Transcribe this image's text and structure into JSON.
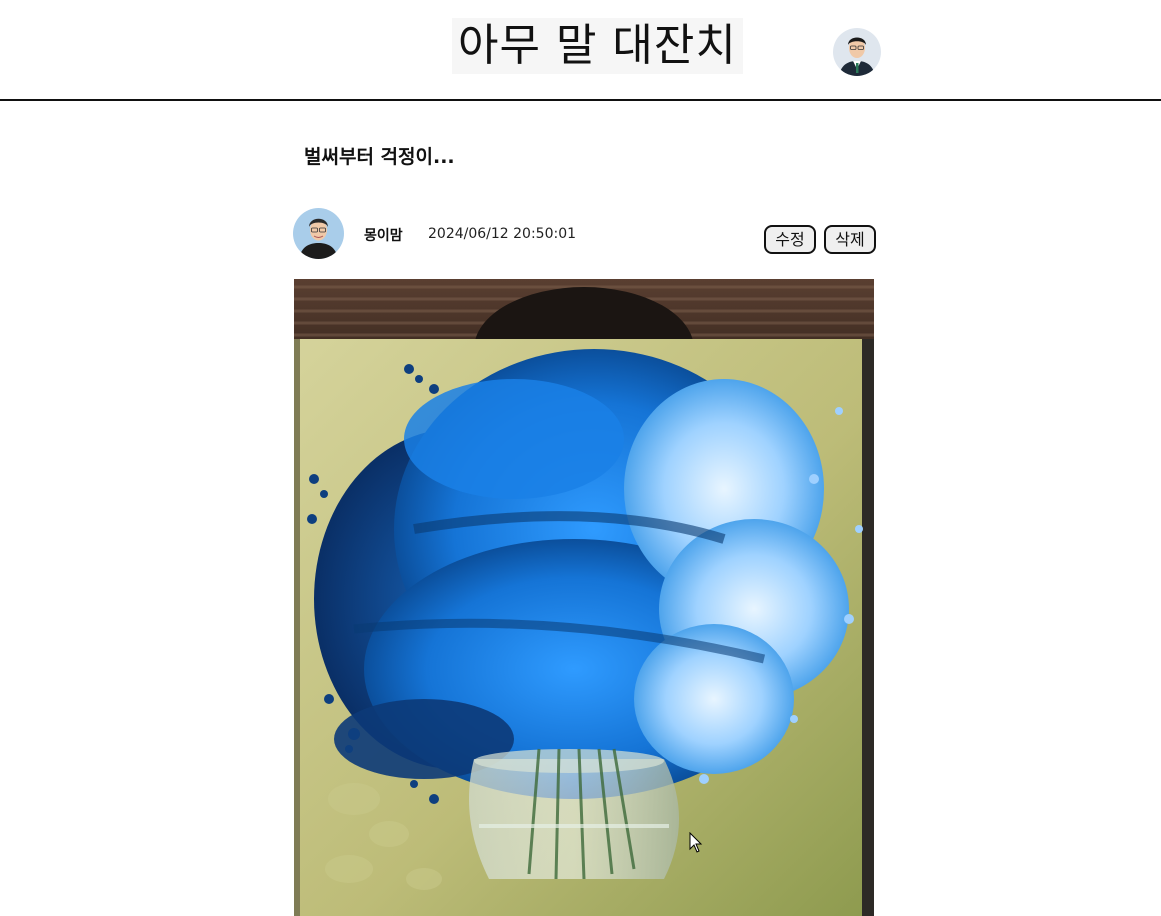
{
  "header": {
    "site_title": "아무 말 대잔치",
    "avatar_icon": "user-avatar-icon"
  },
  "post": {
    "title": "벌써부터 걱정이...",
    "author_name": "몽이맘",
    "date": "2024/06/12 20:50:01",
    "edit_label": "수정",
    "delete_label": "삭제",
    "image_icon": "flower-painting-image"
  },
  "colors": {
    "text": "#111111",
    "divider": "#111111",
    "button_bg": "#efefef",
    "flower_blue": "#1a7fe0",
    "canvas_olive": "#b9b874"
  }
}
